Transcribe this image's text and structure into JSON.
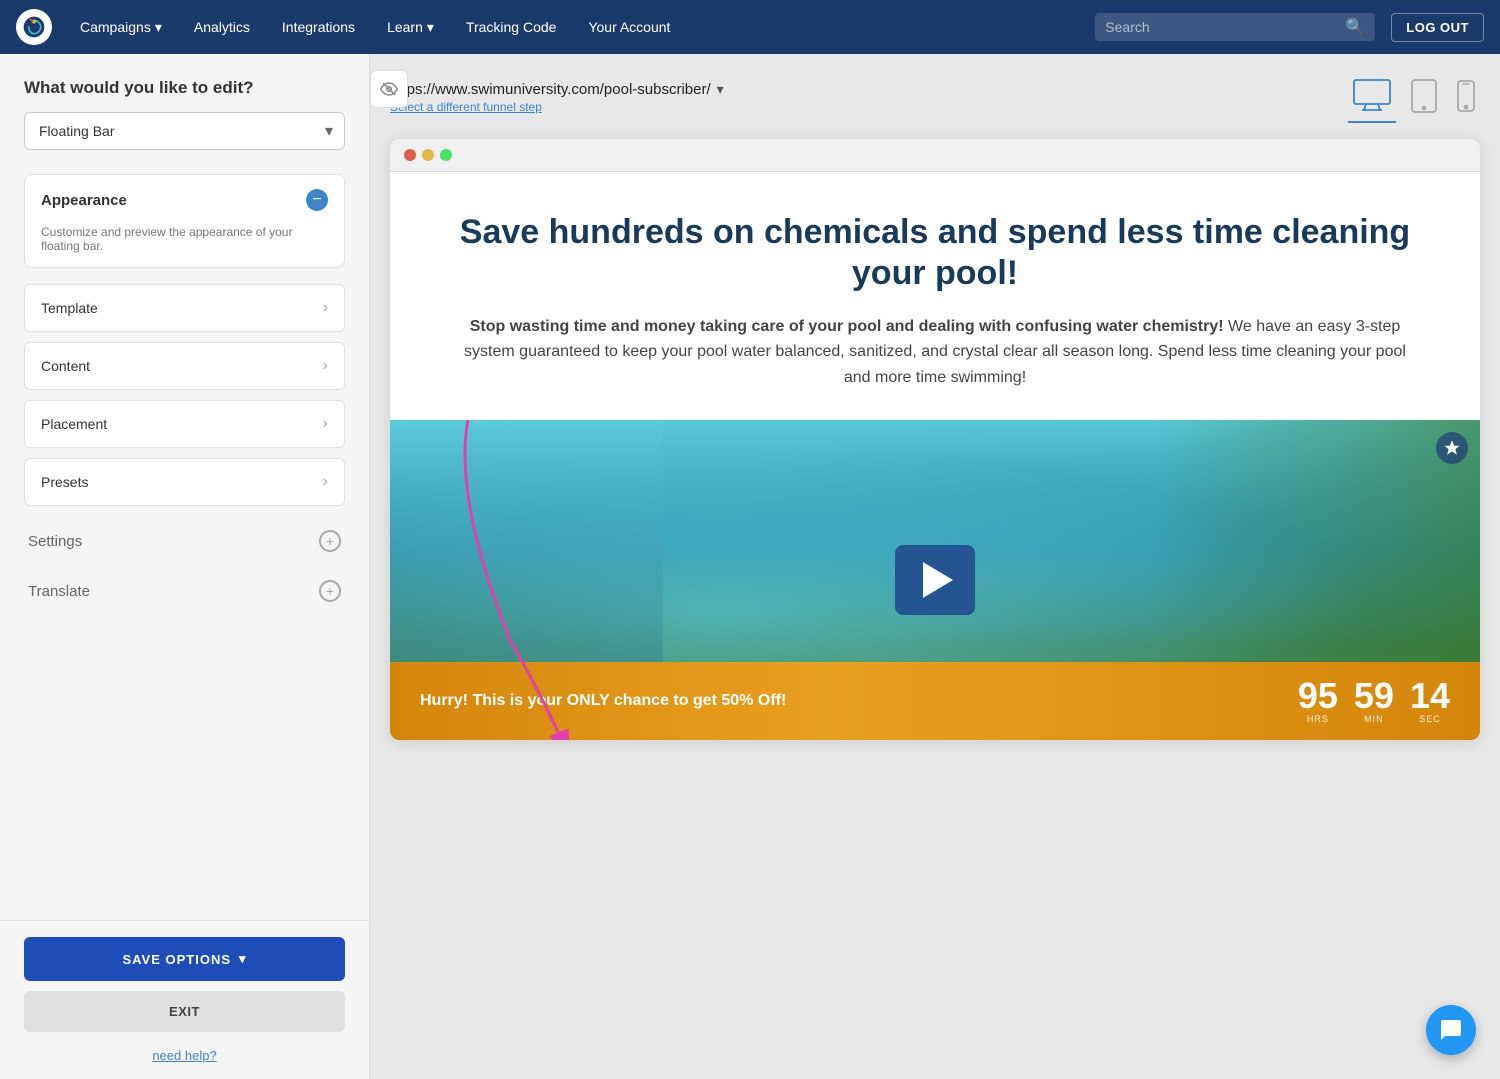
{
  "app": {
    "logo_alt": "Drip logo"
  },
  "navbar": {
    "campaigns_label": "Campaigns",
    "analytics_label": "Analytics",
    "integrations_label": "Integrations",
    "learn_label": "Learn",
    "tracking_code_label": "Tracking Code",
    "your_account_label": "Your Account",
    "search_placeholder": "Search",
    "logout_label": "LOG OUT"
  },
  "sidebar": {
    "question": "What would you like to edit?",
    "select_value": "Floating Bar",
    "appearance_title": "Appearance",
    "appearance_desc": "Customize and preview the appearance of your floating bar.",
    "menu_items": [
      {
        "label": "Template"
      },
      {
        "label": "Content"
      },
      {
        "label": "Placement"
      },
      {
        "label": "Presets"
      }
    ],
    "settings_label": "Settings",
    "translate_label": "Translate",
    "save_options_label": "SAVE OPTIONS",
    "exit_label": "EXIT",
    "need_help_label": "need help?"
  },
  "content": {
    "url": "https://www.swimuniversity.com/pool-subscriber/",
    "select_funnel_link": "Select a different funnel step",
    "headline": "Save hundreds on chemicals and spend less time cleaning your pool!",
    "subtext_bold": "Stop wasting time and money taking care of your pool and dealing with confusing water chemistry!",
    "subtext_normal": " We have an easy 3-step system guaranteed to keep your pool water balanced, sanitized, and crystal clear all season long. Spend less time cleaning your pool and more time swimming!",
    "floating_bar_text": "Hurry! This is your ONLY chance to get 50% Off!",
    "timer": {
      "hours": "95",
      "minutes": "59",
      "seconds": "14",
      "hours_label": "HRS",
      "minutes_label": "MIN",
      "seconds_label": "SEC"
    }
  },
  "devices": {
    "desktop_label": "desktop",
    "tablet_label": "tablet",
    "mobile_label": "mobile"
  },
  "browser": {
    "dot1": "red",
    "dot2": "yellow",
    "dot3": "green"
  },
  "chat": {
    "icon": "chat-icon"
  }
}
